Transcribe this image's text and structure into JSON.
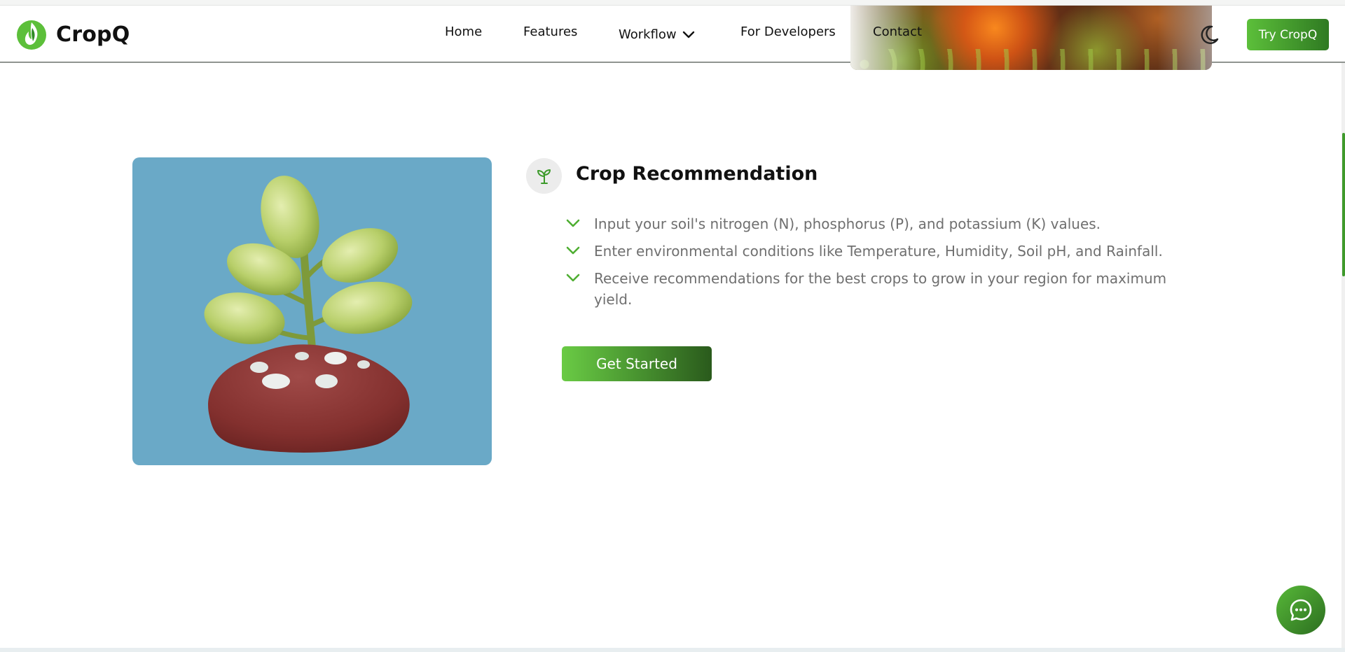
{
  "brand": {
    "name": "CropQ",
    "logo_icon": "leaf-flame-logo-icon",
    "accent": "#4fae32",
    "accent_dark": "#2c6e20"
  },
  "nav": {
    "items": [
      {
        "label": "Home"
      },
      {
        "label": "Features"
      },
      {
        "label": "Workflow",
        "icon": "chevron-down-icon"
      },
      {
        "label": "For Developers"
      },
      {
        "label": "Contact"
      }
    ],
    "theme_toggle_icon": "moon-icon",
    "cta_label": "Try CropQ"
  },
  "feature": {
    "icon": "sprout-icon",
    "title": "Crop Recommendation",
    "bullets": [
      "Input your soil's nitrogen (N), phosphorus (P), and potassium (K) values.",
      "Enter environmental conditions like Temperature, Humidity, Soil pH, and Rainfall.",
      "Receive recommendations for the best crops to grow in your region for maximum yield."
    ],
    "bullet_icon": "check-icon",
    "cta_label": "Get Started",
    "illustration_bg": "#6aa9c7"
  },
  "chat": {
    "icon": "chat-bubble-icon"
  }
}
